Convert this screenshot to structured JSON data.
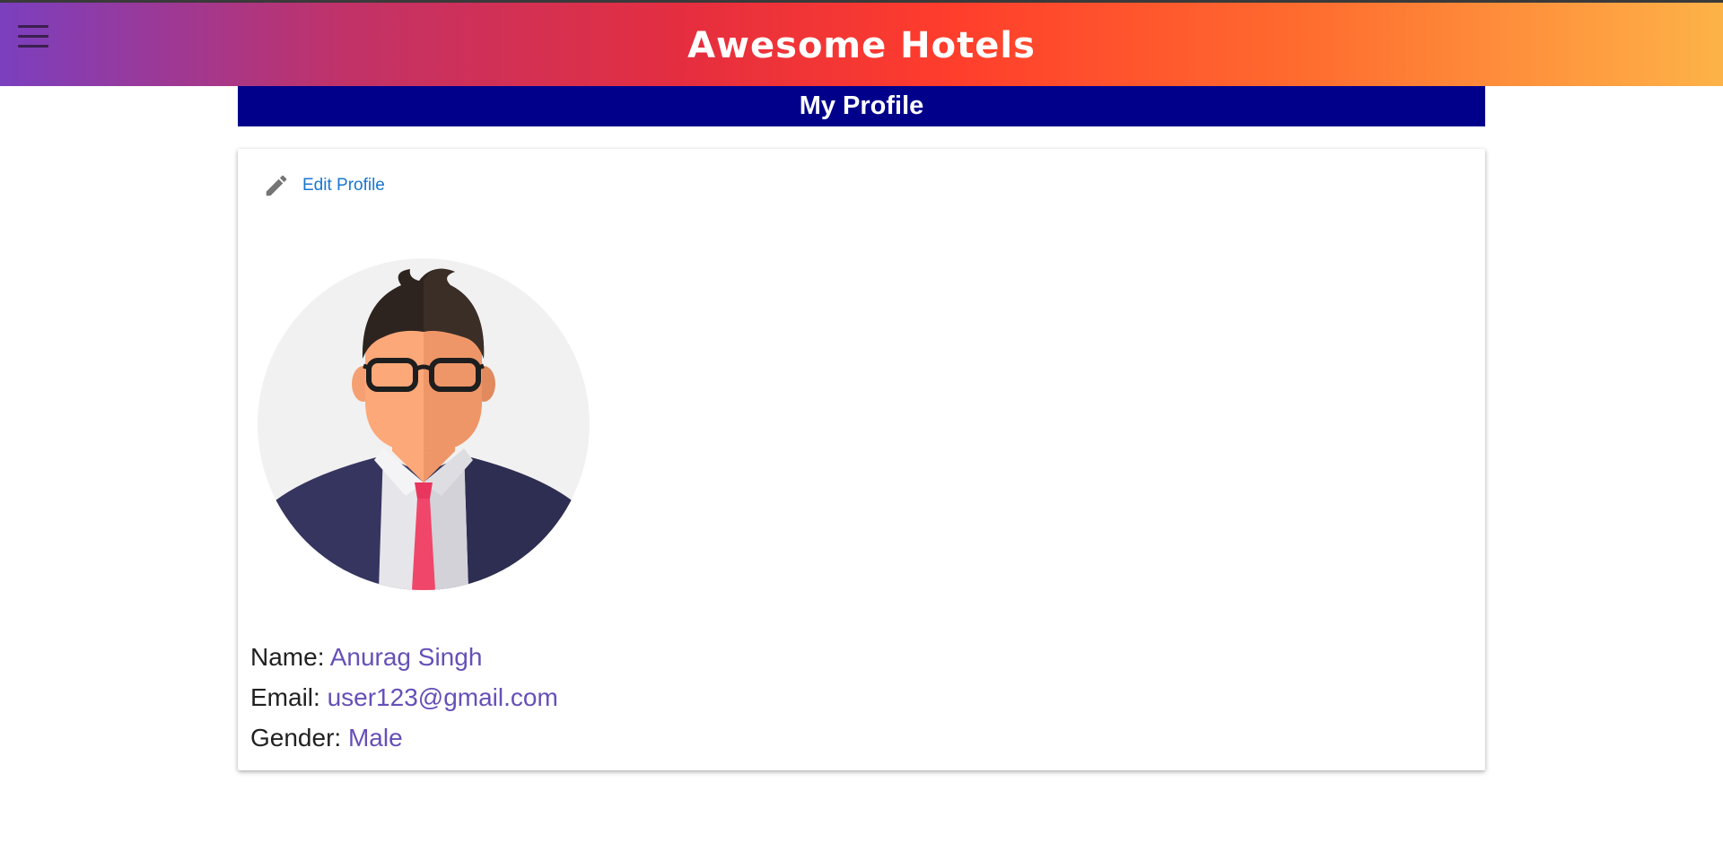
{
  "header": {
    "title": "Awesome Hotels",
    "menu_icon": "hamburger-menu-icon"
  },
  "page": {
    "title": "My Profile"
  },
  "profile": {
    "edit_label": "Edit Profile",
    "edit_icon": "pencil-icon",
    "avatar_icon": "user-avatar",
    "fields": {
      "name_label": "Name:",
      "name_value": "Anurag Singh",
      "email_label": "Email:",
      "email_value": "user123@gmail.com",
      "gender_label": "Gender:",
      "gender_value": "Male"
    }
  },
  "colors": {
    "header_band": "#00008b",
    "link": "#1976d2",
    "value_text": "#6650b8"
  }
}
